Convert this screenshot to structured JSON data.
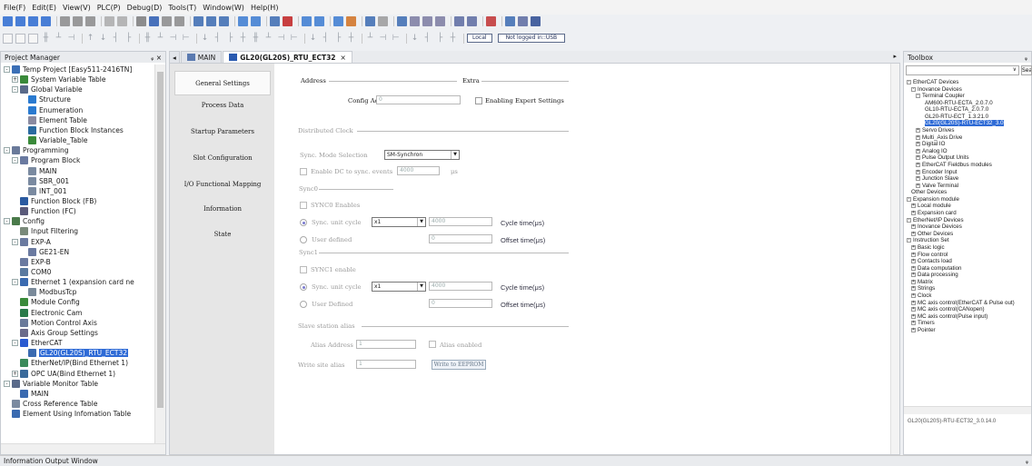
{
  "menu": [
    "File(F)",
    "Edit(E)",
    "View(V)",
    "PLC(P)",
    "Debug(D)",
    "Tools(T)",
    "Window(W)",
    "Help(H)"
  ],
  "toolbar": {
    "local_label": "Local",
    "login_status": "Not logged in::USB"
  },
  "project_manager": {
    "title": "Project Manager",
    "pin": "ᵩ ×",
    "tree": [
      {
        "label": "Temp Project [Easy511-2416TN]",
        "level": 0,
        "exp": "-",
        "icon": "project-icon",
        "color": "#3b6fb6"
      },
      {
        "label": "System Variable Table",
        "level": 1,
        "exp": "+",
        "icon": "gear-icon",
        "color": "#3a8a3a"
      },
      {
        "label": "Global Variable",
        "level": 1,
        "exp": "-",
        "icon": "table-icon",
        "color": "#5a6a8a"
      },
      {
        "label": "Structure",
        "level": 2,
        "exp": "",
        "icon": "structure-icon",
        "color": "#2a7ad0"
      },
      {
        "label": "Enumeration",
        "level": 2,
        "exp": "",
        "icon": "enum-icon",
        "color": "#2a7ad0"
      },
      {
        "label": "Element Table",
        "level": 2,
        "exp": "",
        "icon": "table-icon",
        "color": "#8a8aa0"
      },
      {
        "label": "Function Block Instances",
        "level": 2,
        "exp": "",
        "icon": "fb-icon",
        "color": "#2a6aa0"
      },
      {
        "label": "Variable_Table",
        "level": 2,
        "exp": "",
        "icon": "gear-icon",
        "color": "#3a8a3a"
      },
      {
        "label": "Programming",
        "level": 0,
        "exp": "-",
        "icon": "program-icon",
        "color": "#6a7a9a"
      },
      {
        "label": "Program Block",
        "level": 1,
        "exp": "-",
        "icon": "folder-icon",
        "color": "#6a7aa0"
      },
      {
        "label": "MAIN",
        "level": 2,
        "exp": "",
        "icon": "file-icon",
        "color": "#7a8aa0"
      },
      {
        "label": "SBR_001",
        "level": 2,
        "exp": "",
        "icon": "file-icon",
        "color": "#7a8aa0"
      },
      {
        "label": "INT_001",
        "level": 2,
        "exp": "",
        "icon": "file-icon",
        "color": "#7a8aa0"
      },
      {
        "label": "Function Block (FB)",
        "level": 1,
        "exp": "",
        "icon": "fb-icon",
        "color": "#2a5aa0"
      },
      {
        "label": "Function (FC)",
        "level": 1,
        "exp": "",
        "icon": "fc-icon",
        "color": "#5a5a7a"
      },
      {
        "label": "Config",
        "level": 0,
        "exp": "-",
        "icon": "config-icon",
        "color": "#4a7a4a"
      },
      {
        "label": "Input Filtering",
        "level": 1,
        "exp": "",
        "icon": "filter-icon",
        "color": "#7a8a7a"
      },
      {
        "label": "EXP-A",
        "level": 1,
        "exp": "-",
        "icon": "module-icon",
        "color": "#6a7aa0"
      },
      {
        "label": "GE21-EN",
        "level": 2,
        "exp": "",
        "icon": "module-icon",
        "color": "#6a7aa0"
      },
      {
        "label": "EXP-B",
        "level": 1,
        "exp": "",
        "icon": "module-icon",
        "color": "#6a7aa0"
      },
      {
        "label": "COM0",
        "level": 1,
        "exp": "",
        "icon": "port-icon",
        "color": "#5a7aa0"
      },
      {
        "label": "Ethernet 1 (expansion card ne",
        "level": 1,
        "exp": "-",
        "icon": "network-icon",
        "color": "#3a6ab0"
      },
      {
        "label": "ModbusTcp",
        "level": 2,
        "exp": "",
        "icon": "gear-icon",
        "color": "#7a8a9a"
      },
      {
        "label": "Module Config",
        "level": 1,
        "exp": "",
        "icon": "module-config-icon",
        "color": "#3a8a3a"
      },
      {
        "label": "Electronic Cam",
        "level": 1,
        "exp": "",
        "icon": "cam-icon",
        "color": "#2a7a4a"
      },
      {
        "label": "Motion Control Axis",
        "level": 1,
        "exp": "",
        "icon": "axis-icon",
        "color": "#6a7a9a"
      },
      {
        "label": "Axis Group Settings",
        "level": 1,
        "exp": "",
        "icon": "axis-group-icon",
        "color": "#6a6a8a"
      },
      {
        "label": "EtherCAT",
        "level": 1,
        "exp": "-",
        "icon": "ethercat-icon",
        "color": "#2a5ad0"
      },
      {
        "label": "GL20(GL20S)_RTU_ECT32",
        "level": 2,
        "exp": "",
        "icon": "device-icon",
        "color": "#3a6ab0",
        "selected": true
      },
      {
        "label": "EtherNet/IP(Bind Ethernet 1)",
        "level": 1,
        "exp": "",
        "icon": "ethernetip-icon",
        "color": "#3a8a5a"
      },
      {
        "label": "OPC UA(Bind Ethernet 1)",
        "level": 1,
        "exp": "+",
        "icon": "opcua-icon",
        "color": "#3a6a9a"
      },
      {
        "label": "Variable Monitor Table",
        "level": 0,
        "exp": "-",
        "icon": "monitor-icon",
        "color": "#5a6a8a"
      },
      {
        "label": "MAIN",
        "level": 1,
        "exp": "",
        "icon": "table-icon",
        "color": "#3a6ab0"
      },
      {
        "label": "Cross Reference Table",
        "level": 0,
        "exp": "",
        "icon": "cross-ref-icon",
        "color": "#7a8aa0"
      },
      {
        "label": "Element Using Infomation Table",
        "level": 0,
        "exp": "",
        "icon": "table-icon",
        "color": "#3a6ab0"
      }
    ]
  },
  "tabs": [
    {
      "label": "MAIN",
      "active": false
    },
    {
      "label": "GL20(GL20S)_RTU_ECT32",
      "active": true,
      "close": "×"
    }
  ],
  "tab_nav_left": "◂",
  "tab_nav_right": "▸",
  "left_nav": [
    "General Settings",
    "Process Data",
    "Startup Parameters",
    "Slot Configuration",
    "I/O Functional Mapping",
    "Information",
    "State"
  ],
  "general": {
    "address_label": "Address",
    "extra_label": "Extra",
    "config_addr_label": "Config Addr.",
    "config_addr_value": "0",
    "expert_label": "Enabling Expert Settings",
    "distributed_clock_label": "Distributed Clock",
    "sync_mode_label": "Sync. Mode Selection",
    "sync_mode_value": "SM-Synchron",
    "enable_dc_label": "Enable DC to sync. events",
    "enable_dc_value": "4000",
    "enable_dc_unit": "μs",
    "sync0_label": "Sync0",
    "sync0_enable_label": "SYNC0 Enables",
    "sync0_cycle_label": "Sync. unit cycle",
    "sync0_cycle_value": "x1",
    "sync0_cycle_time": "4000",
    "sync0_cycle_time_label": "Cycle time(μs)",
    "sync0_user_label": "User defined",
    "sync0_user_value": "0",
    "sync0_offset_label": "Offset time(μs)",
    "sync1_label": "Sync1",
    "sync1_enable_label": "SYNC1 enable",
    "sync1_cycle_label": "Sync. unit cycle",
    "sync1_cycle_value": "x1",
    "sync1_cycle_time": "4000",
    "sync1_cycle_time_label": "Cycle time(μs)",
    "sync1_user_label": "User Defined",
    "sync1_user_value": "0",
    "sync1_offset_label": "Offset time(μs)",
    "alias_section_label": "Slave station alias",
    "alias_address_label": "Alias Address",
    "alias_address_value": "1",
    "alias_enabled_label": "Alias enabled",
    "write_alias_label": "Write site alias",
    "write_alias_value": "1",
    "write_eeprom_label": "Write to EEPROM"
  },
  "toolbox": {
    "title": "Toolbox",
    "pin": "ᵩ",
    "search_label": "Search",
    "items": [
      {
        "label": "EtherCAT Devices",
        "level": 0,
        "exp": "-"
      },
      {
        "label": "Inovance Devices",
        "level": 1,
        "exp": "-"
      },
      {
        "label": "Terminal Coupler",
        "level": 2,
        "exp": "-"
      },
      {
        "label": "AM600-RTU-ECTA_2.0.7.0",
        "level": 4,
        "exp": ""
      },
      {
        "label": "GL10-RTU-ECTA_2.0.7.0",
        "level": 4,
        "exp": ""
      },
      {
        "label": "GL20-RTU-ECT_1.3.21.0",
        "level": 4,
        "exp": ""
      },
      {
        "label": "GL20(GL20S)-RTU-ECT32_3.0",
        "level": 4,
        "exp": "",
        "selected": true
      },
      {
        "label": "Servo Drives",
        "level": 2,
        "exp": "+"
      },
      {
        "label": "Multi_Axis Drive",
        "level": 2,
        "exp": "+"
      },
      {
        "label": "Digital IO",
        "level": 2,
        "exp": "+"
      },
      {
        "label": "Analog IO",
        "level": 2,
        "exp": "+"
      },
      {
        "label": "Pulse Output Units",
        "level": 2,
        "exp": "+"
      },
      {
        "label": "EtherCAT Fieldbus modules",
        "level": 2,
        "exp": "+"
      },
      {
        "label": "Encoder Input",
        "level": 2,
        "exp": "+"
      },
      {
        "label": "Junction Slave",
        "level": 2,
        "exp": "+"
      },
      {
        "label": "Valve Terminal",
        "level": 2,
        "exp": "+"
      },
      {
        "label": "Other Devices",
        "level": 1,
        "exp": ""
      },
      {
        "label": "Expansion module",
        "level": 0,
        "exp": "-"
      },
      {
        "label": "Local module",
        "level": 1,
        "exp": "+"
      },
      {
        "label": "Expansion card",
        "level": 1,
        "exp": "+"
      },
      {
        "label": "EtherNet/IP Devices",
        "level": 0,
        "exp": "-"
      },
      {
        "label": "Inovance Devices",
        "level": 1,
        "exp": "+"
      },
      {
        "label": "Other Devices",
        "level": 1,
        "exp": "+"
      },
      {
        "label": "Instruction Set",
        "level": 0,
        "exp": "-"
      },
      {
        "label": "Basic logic",
        "level": 1,
        "exp": "+"
      },
      {
        "label": "Flow control",
        "level": 1,
        "exp": "+"
      },
      {
        "label": "Contacts load",
        "level": 1,
        "exp": "+"
      },
      {
        "label": "Data computation",
        "level": 1,
        "exp": "+"
      },
      {
        "label": "Data processing",
        "level": 1,
        "exp": "+"
      },
      {
        "label": "Matrix",
        "level": 1,
        "exp": "+"
      },
      {
        "label": "Strings",
        "level": 1,
        "exp": "+"
      },
      {
        "label": "Clock",
        "level": 1,
        "exp": "+"
      },
      {
        "label": "MC axis control(EtherCAT & Pulse out)",
        "level": 1,
        "exp": "+"
      },
      {
        "label": "MC axis control(CANopen)",
        "level": 1,
        "exp": "+"
      },
      {
        "label": "MC axis control(Pulse input)",
        "level": 1,
        "exp": "+"
      },
      {
        "label": "Timers",
        "level": 1,
        "exp": "+"
      },
      {
        "label": "Pointer",
        "level": 1,
        "exp": "+"
      }
    ],
    "description": "GL20(GL20S)-RTU-ECT32_3.0.14.0"
  },
  "status_bar": {
    "label": "Information Output Window",
    "pin": "ᵩ"
  }
}
